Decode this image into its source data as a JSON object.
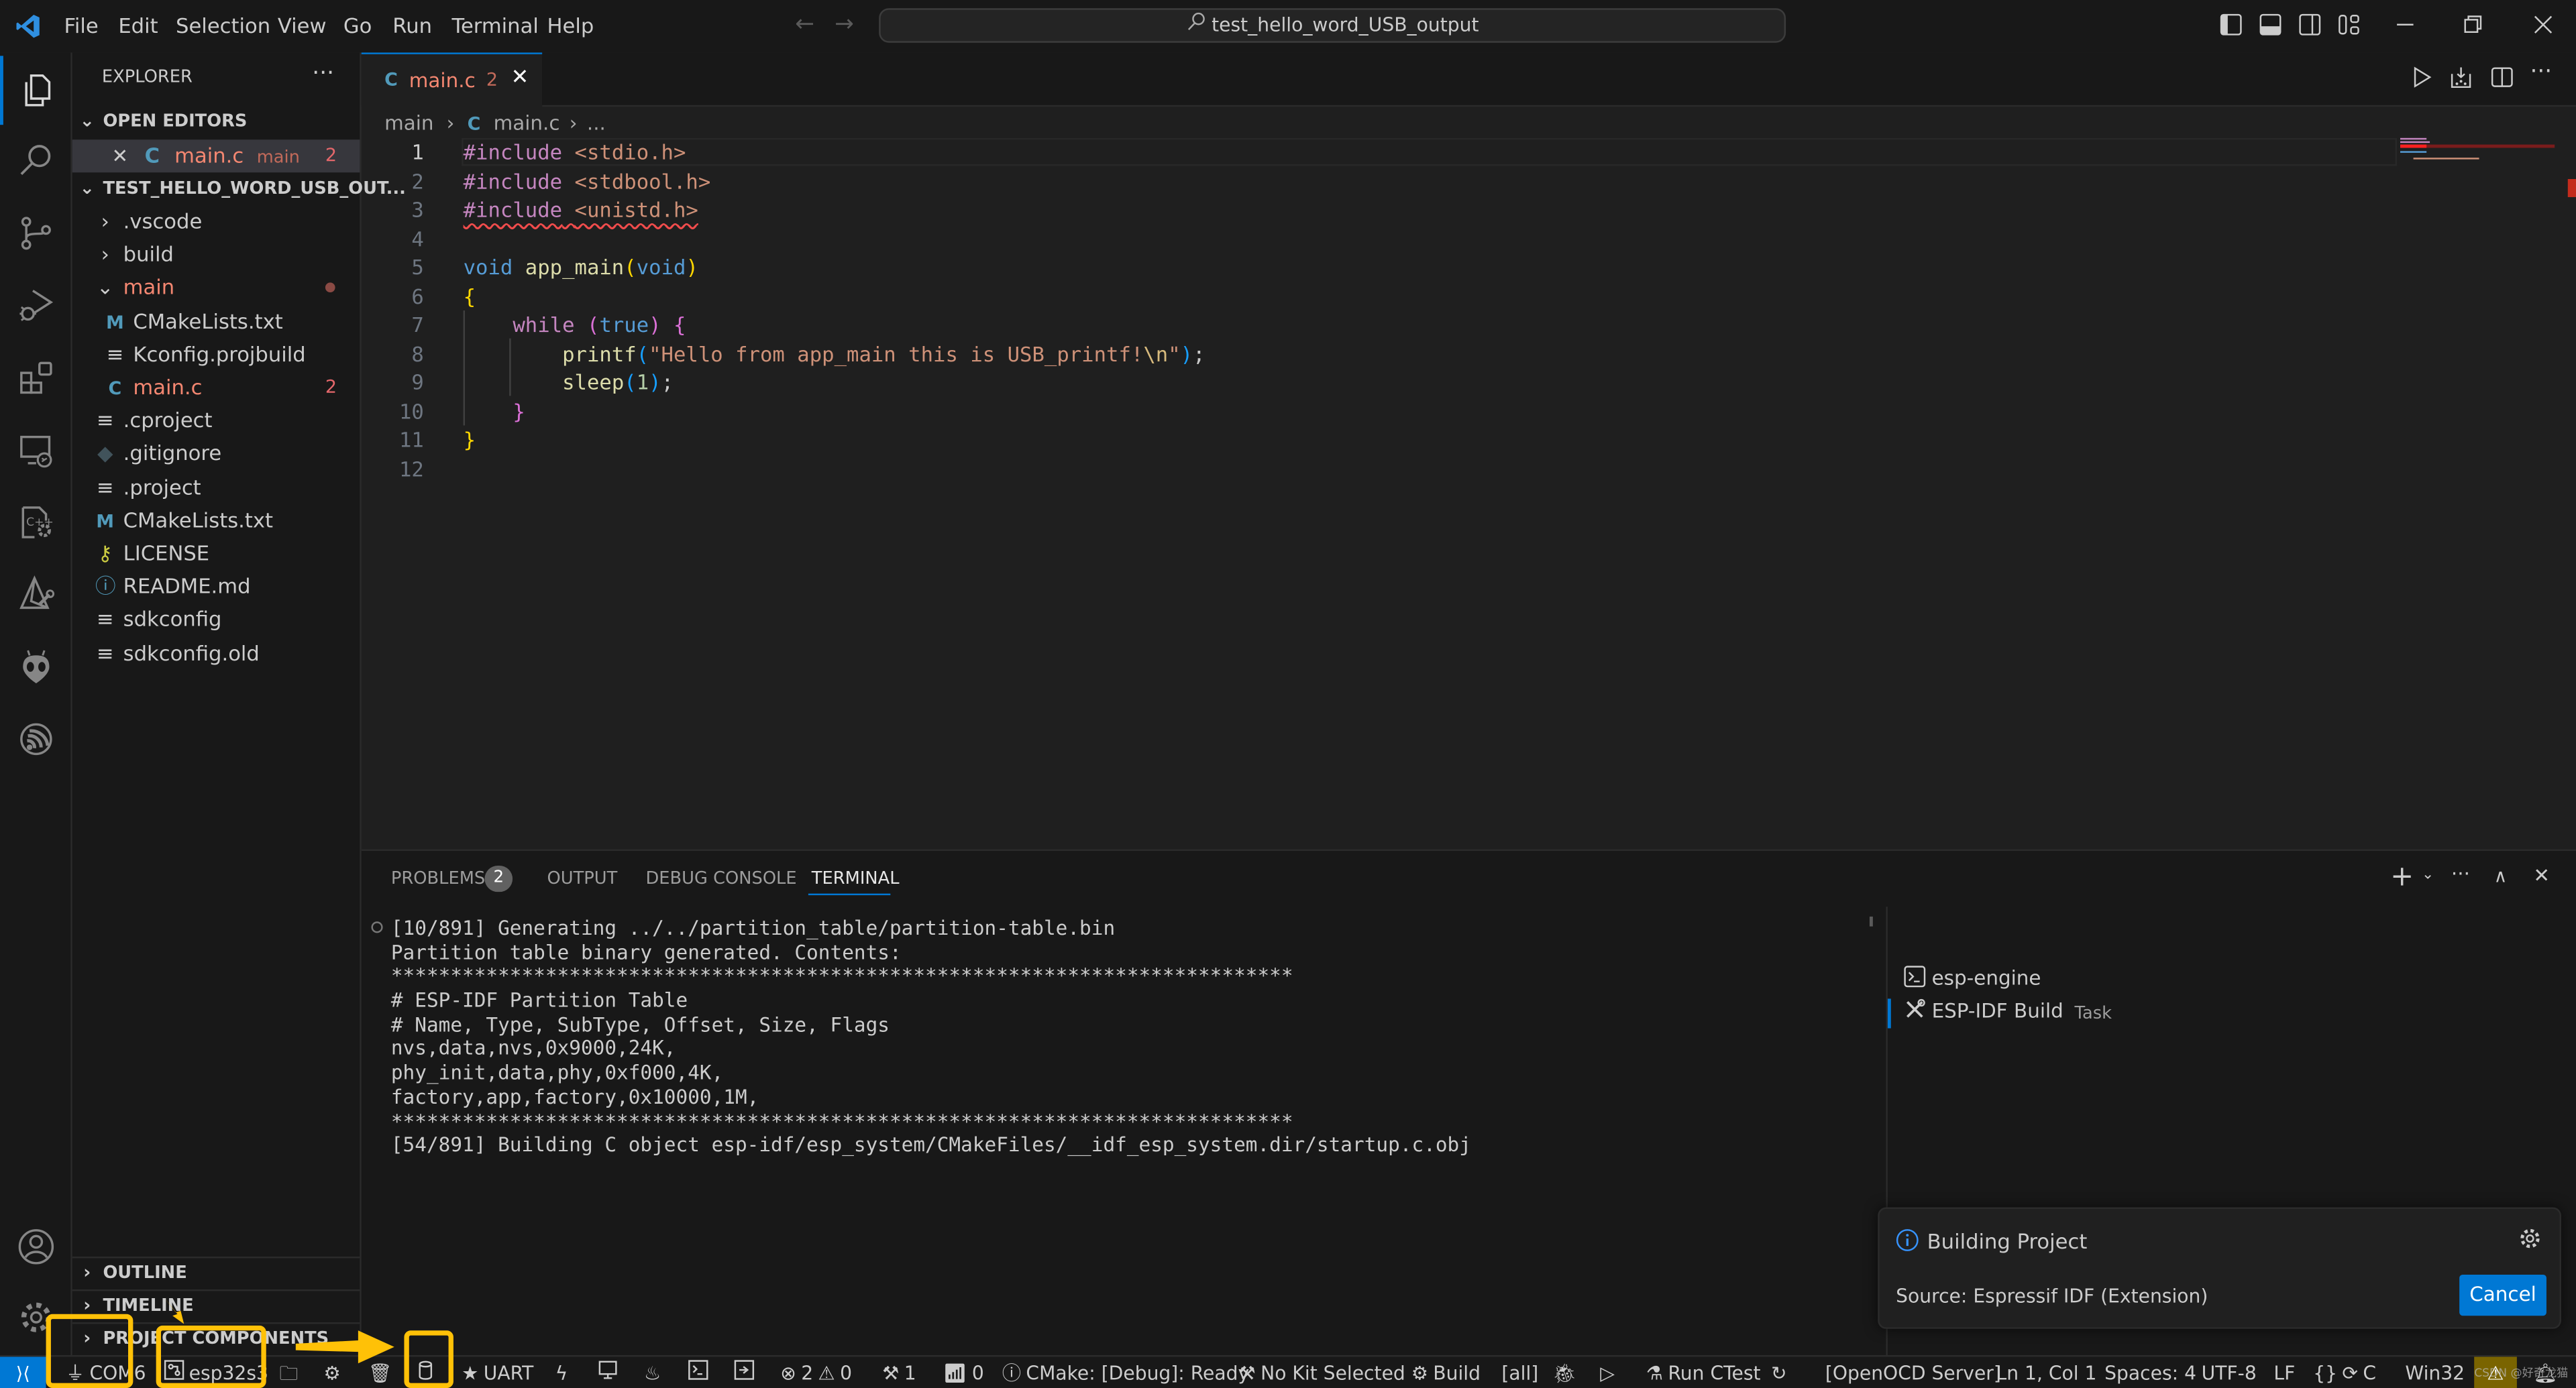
{
  "titlebar": {
    "menu": [
      "File",
      "Edit",
      "Selection",
      "View",
      "Go",
      "Run",
      "Terminal",
      "Help"
    ],
    "search_text": "test_hello_word_USB_output"
  },
  "sidebar": {
    "title": "EXPLORER",
    "open_editors_label": "OPEN EDITORS",
    "open_editor": {
      "name": "main.c",
      "folder": "main",
      "problems": "2"
    },
    "project_label": "TEST_HELLO_WORD_USB_OUT...",
    "tree": [
      {
        "name": ".vscode",
        "type": "folder"
      },
      {
        "name": "build",
        "type": "folder"
      },
      {
        "name": "main",
        "type": "folder-open"
      },
      {
        "name": "CMakeLists.txt",
        "type": "cmake",
        "indent": 1
      },
      {
        "name": "Kconfig.projbuild",
        "type": "file",
        "indent": 1
      },
      {
        "name": "main.c",
        "type": "c",
        "indent": 1,
        "problems": "2"
      },
      {
        "name": ".cproject",
        "type": "file"
      },
      {
        "name": ".gitignore",
        "type": "git"
      },
      {
        "name": ".project",
        "type": "file"
      },
      {
        "name": "CMakeLists.txt",
        "type": "cmake"
      },
      {
        "name": "LICENSE",
        "type": "license"
      },
      {
        "name": "README.md",
        "type": "info"
      },
      {
        "name": "sdkconfig",
        "type": "file"
      },
      {
        "name": "sdkconfig.old",
        "type": "file"
      }
    ],
    "bottom_sections": [
      "OUTLINE",
      "TIMELINE",
      "PROJECT COMPONENTS"
    ]
  },
  "editor": {
    "tab": {
      "name": "main.c",
      "problems": "2"
    },
    "breadcrumb": [
      "main",
      "main.c",
      "..."
    ],
    "line_numbers": [
      "1",
      "2",
      "3",
      "4",
      "5",
      "6",
      "7",
      "8",
      "9",
      "10",
      "11",
      "12"
    ],
    "code": {
      "l1_kw": "#include",
      "l1_hdr": "<stdio.h>",
      "l2_kw": "#include",
      "l2_hdr": "<stdbool.h>",
      "l3_kw": "#include",
      "l3_hdr": "<unistd.h>",
      "l5_type": "void",
      "l5_fn": "app_main",
      "l5_arg": "void",
      "l7_kw": "while",
      "l7_cond": "true",
      "l8_fn": "printf",
      "l8_str": "\"Hello from app_main this is USB_printf!",
      "l8_esc": "\\n",
      "l9_fn": "sleep",
      "l9_num": "1"
    }
  },
  "panel": {
    "tabs": [
      "PROBLEMS",
      "OUTPUT",
      "DEBUG CONSOLE",
      "TERMINAL"
    ],
    "problems_count": "2",
    "active_tab": "TERMINAL",
    "terminal_lines": [
      "[10/891] Generating ../../partition_table/partition-table.bin",
      "Partition table binary generated. Contents:",
      "****************************************************************************",
      "# ESP-IDF Partition Table",
      "# Name, Type, SubType, Offset, Size, Flags",
      "nvs,data,nvs,0x9000,24K,",
      "phy_init,data,phy,0xf000,4K,",
      "factory,app,factory,0x10000,1M,",
      "****************************************************************************",
      "[54/891] Building C object esp-idf/esp_system/CMakeFiles/__idf_esp_system.dir/startup.c.obj"
    ],
    "terminals": [
      {
        "name": "esp-engine",
        "suffix": ""
      },
      {
        "name": "ESP-IDF Build",
        "suffix": "Task"
      }
    ]
  },
  "notification": {
    "title": "Building Project",
    "source": "Source: Espressif IDF (Extension)",
    "cancel_label": "Cancel"
  },
  "statusbar": {
    "port": "COM6",
    "target": "esp32s3",
    "uart": "UART",
    "errors": "2",
    "warnings": "0",
    "tools": "1",
    "ports": "0",
    "cmake_status": "CMake: [Debug]: Ready",
    "kit": "No Kit Selected",
    "build": "Build",
    "build_target": "[all]",
    "run_ctest": "Run CTest",
    "openocd": "[OpenOCD Server]",
    "cursor": "Ln 1, Col 1",
    "spaces": "Spaces: 4",
    "encoding": "UTF-8",
    "eol": "LF",
    "language": "C",
    "platform": "Win32",
    "watermark": "CSDN @好奇龙猫"
  }
}
